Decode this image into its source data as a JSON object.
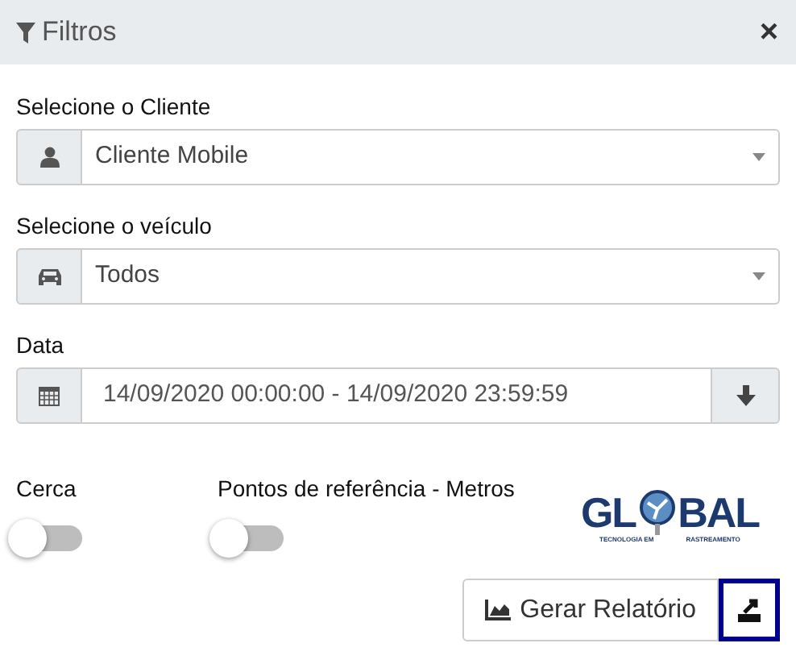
{
  "header": {
    "title": "Filtros",
    "close": "×"
  },
  "fields": [
    {
      "label": "Selecione o Cliente",
      "kind": "select",
      "value": "Cliente Mobile"
    },
    {
      "label": "Selecione o veículo",
      "kind": "select",
      "value": "Todos"
    },
    {
      "label": "Data",
      "kind": "daterange",
      "value": "14/09/2020 00:00:00 - 14/09/2020 23:59:59"
    }
  ],
  "toggles": [
    {
      "label": "Cerca",
      "on": false
    },
    {
      "label": "Pontos de referência - Metros",
      "on": false
    }
  ],
  "logo": {
    "left": "GL",
    "right": "BAL",
    "tagline_left": "TECNOLOGIA EM",
    "tagline_right": "RASTREAMENTO"
  },
  "buttons": {
    "report": "Gerar Relatório"
  }
}
